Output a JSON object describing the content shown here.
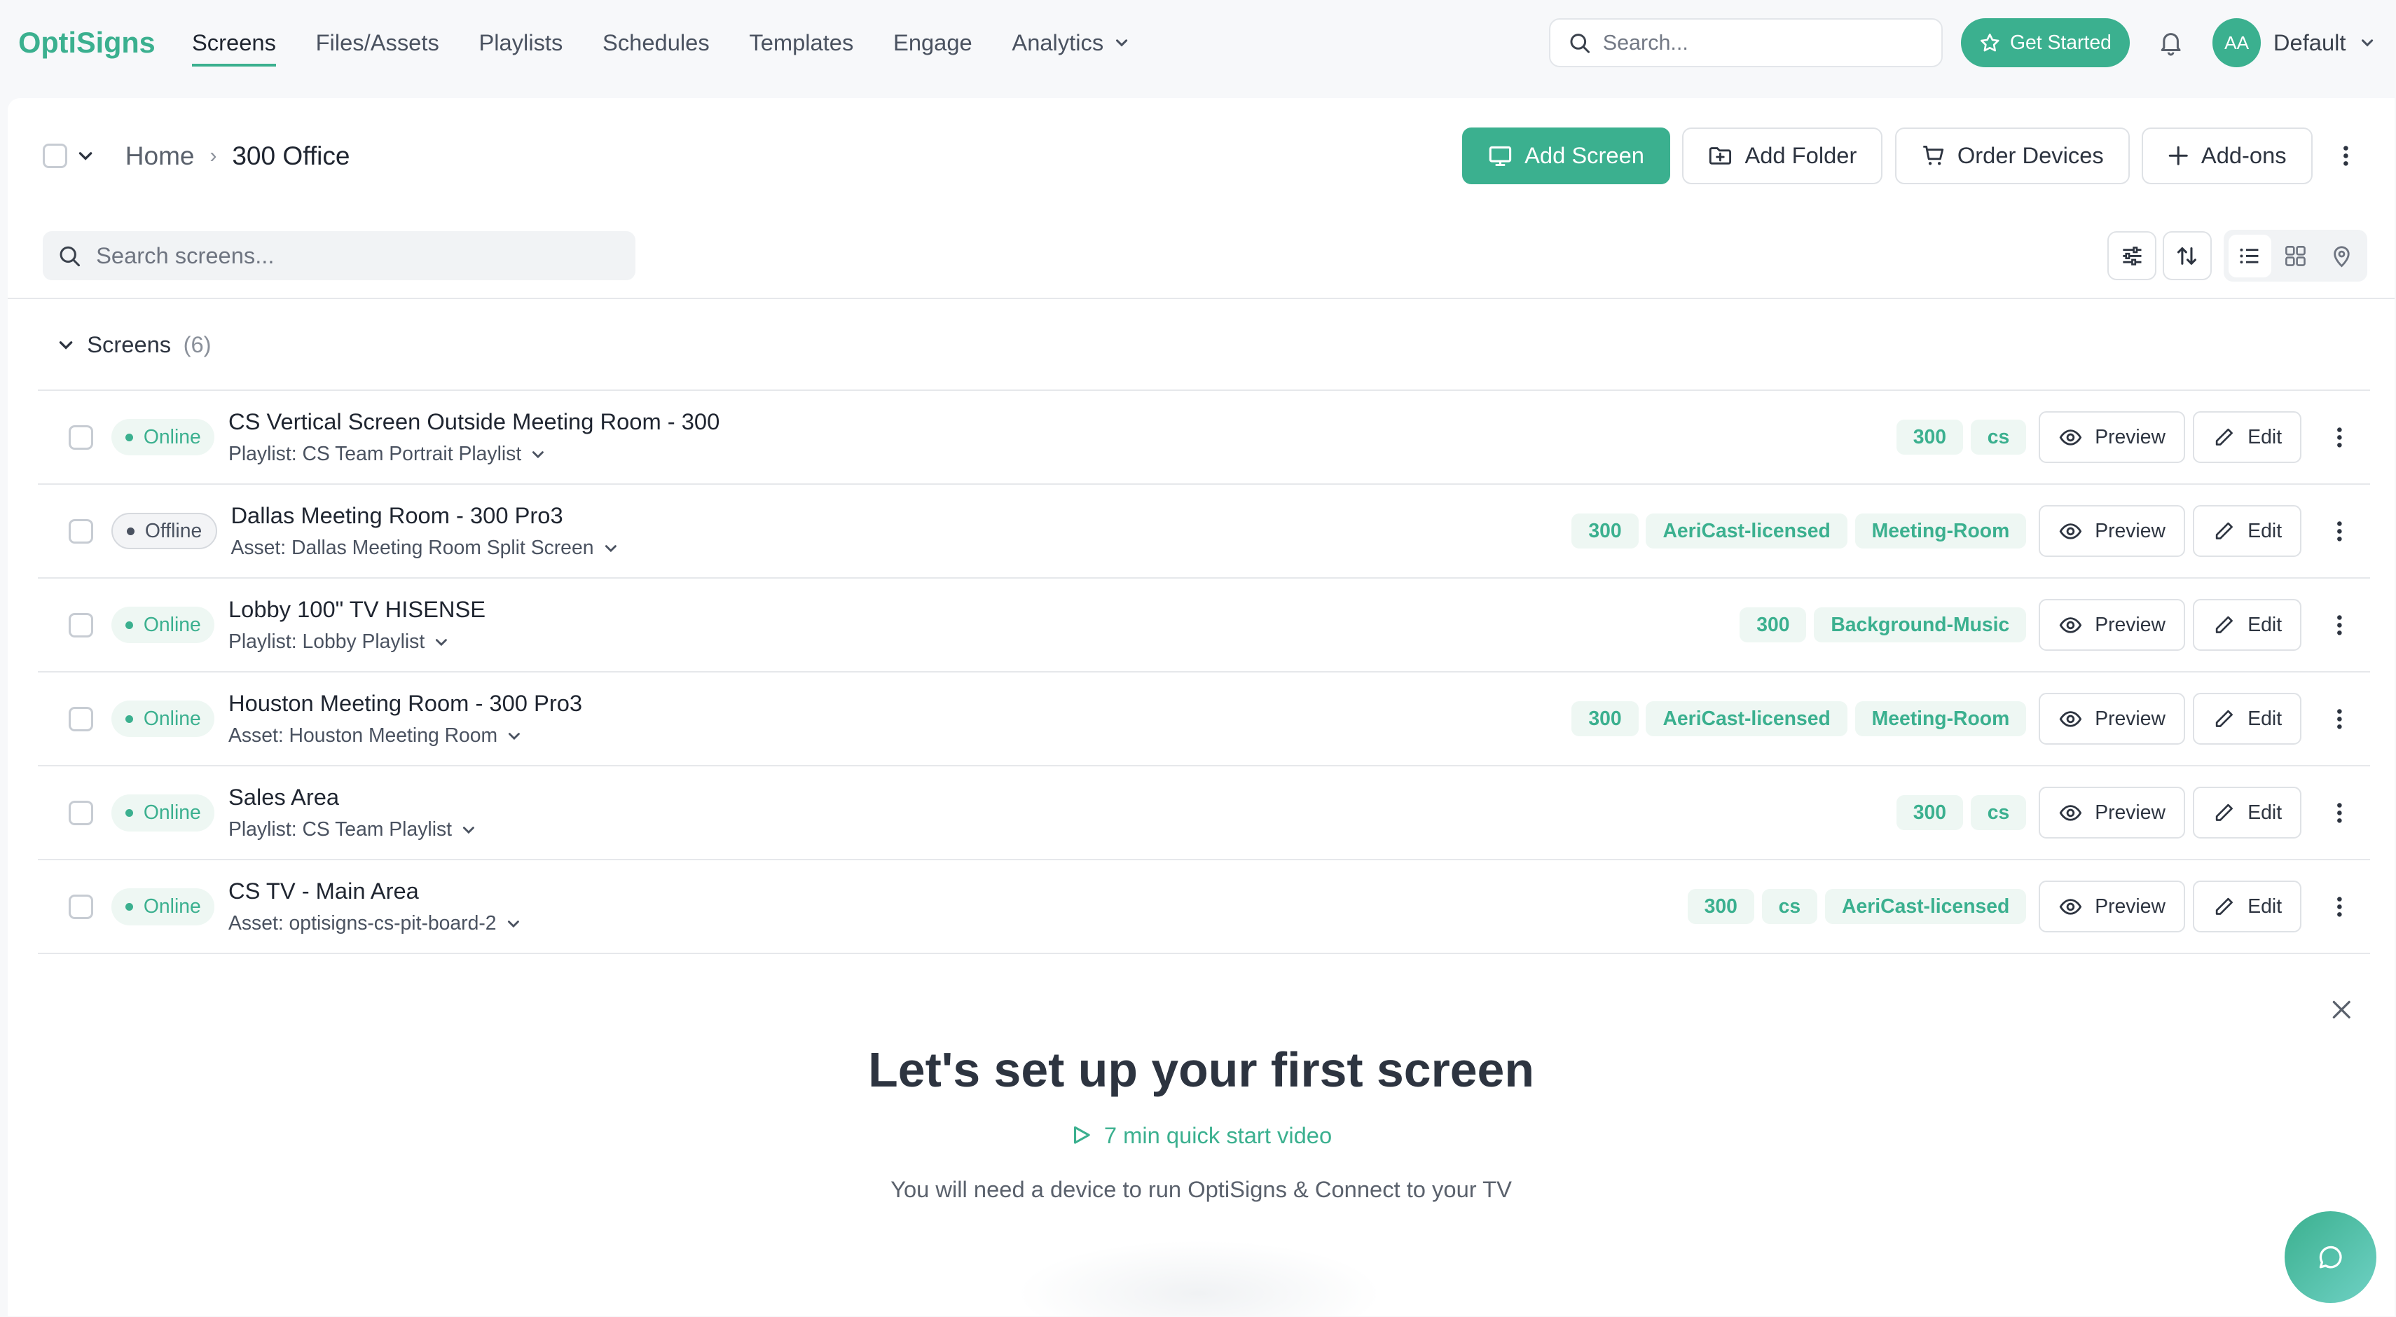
{
  "app": {
    "logo": "OptiSigns"
  },
  "nav": {
    "items": [
      {
        "label": "Screens",
        "active": true
      },
      {
        "label": "Files/Assets"
      },
      {
        "label": "Playlists"
      },
      {
        "label": "Schedules"
      },
      {
        "label": "Templates"
      },
      {
        "label": "Engage"
      },
      {
        "label": "Analytics",
        "dropdown": true
      }
    ]
  },
  "header": {
    "search_placeholder": "Search...",
    "get_started": "Get Started",
    "avatar_initials": "AA",
    "account_name": "Default"
  },
  "breadcrumb": {
    "home": "Home",
    "current": "300 Office"
  },
  "actions": {
    "add_screen": "Add Screen",
    "add_folder": "Add Folder",
    "order_devices": "Order Devices",
    "add_ons": "Add-ons"
  },
  "screen_search": {
    "placeholder": "Search screens..."
  },
  "section": {
    "title": "Screens",
    "count": "(6)"
  },
  "screens": [
    {
      "status": "Online",
      "name": "CS Vertical Screen Outside Meeting Room - 300",
      "sub": "Playlist: CS Team Portrait Playlist",
      "tags": [
        "300",
        "cs"
      ]
    },
    {
      "status": "Offline",
      "name": "Dallas Meeting Room - 300 Pro3",
      "sub": "Asset: Dallas Meeting Room Split Screen",
      "tags": [
        "300",
        "AeriCast-licensed",
        "Meeting-Room"
      ]
    },
    {
      "status": "Online",
      "name": "Lobby 100\" TV HISENSE",
      "sub": "Playlist: Lobby Playlist",
      "tags": [
        "300",
        "Background-Music"
      ]
    },
    {
      "status": "Online",
      "name": "Houston Meeting Room - 300 Pro3",
      "sub": "Asset: Houston Meeting Room",
      "tags": [
        "300",
        "AeriCast-licensed",
        "Meeting-Room"
      ]
    },
    {
      "status": "Online",
      "name": "Sales Area",
      "sub": "Playlist: CS Team Playlist",
      "tags": [
        "300",
        "cs"
      ]
    },
    {
      "status": "Online",
      "name": "CS TV - Main Area",
      "sub": "Asset: optisigns-cs-pit-board-2",
      "tags": [
        "300",
        "cs",
        "AeriCast-licensed"
      ]
    }
  ],
  "row_actions": {
    "preview": "Preview",
    "edit": "Edit"
  },
  "setup": {
    "title": "Let's set up your first screen",
    "video": "7 min quick start video",
    "need": "You will need a device to run OptiSigns & Connect to your TV"
  },
  "colors": {
    "accent": "#3bb08f",
    "text": "#2d3440"
  }
}
